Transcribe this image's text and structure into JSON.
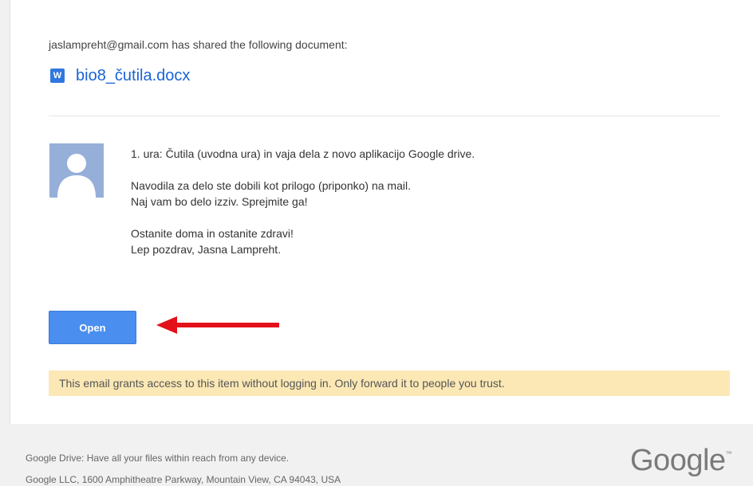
{
  "email": {
    "sharer_line": "jaslampreht@gmail.com has shared the following document:",
    "document": {
      "icon": "word-doc-icon",
      "icon_letter": "W",
      "name": "bio8_čutila.docx"
    },
    "message": {
      "line1": "1. ura: Čutila (uvodna ura) in vaja dela z novo aplikacijo Google drive.",
      "line2": "Navodila za delo ste dobili kot prilogo (priponko) na mail.",
      "line3": "Naj vam bo delo izziv. Sprejmite ga!",
      "line4": "Ostanite doma in ostanite zdravi!",
      "line5": "Lep pozdrav, Jasna Lampreht."
    },
    "open_button": "Open",
    "notice": "This email grants access to this item without logging in. Only forward it to people you trust."
  },
  "footer": {
    "line1": "Google Drive: Have all your files within reach from any device.",
    "line2": "Google LLC, 1600 Amphitheatre Parkway, Mountain View, CA 94043, USA",
    "logo_text": "Google",
    "logo_tm": "™"
  },
  "colors": {
    "link": "#1a64d4",
    "button": "#4a8ff0",
    "notice_bg": "#fbe8b5",
    "arrow": "#e3101a",
    "avatar_bg": "#96afd9"
  }
}
